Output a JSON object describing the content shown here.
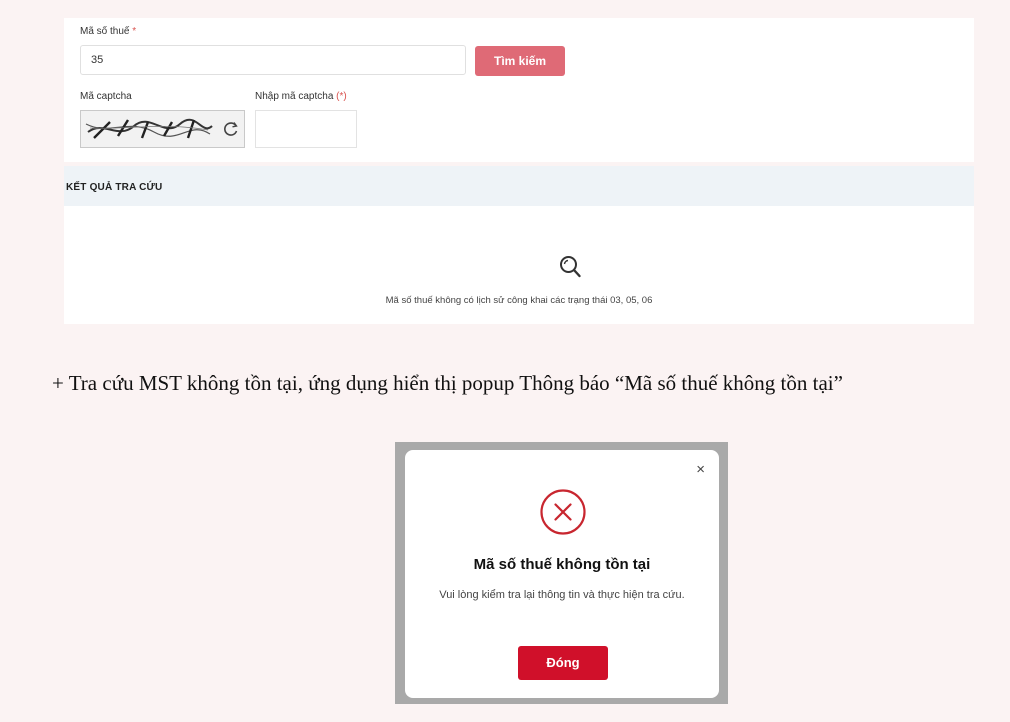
{
  "form": {
    "tax_code_label": "Mã số thuế",
    "tax_code_required": "*",
    "tax_code_value": "35",
    "search_button": "Tìm kiếm",
    "captcha_label": "Mã captcha",
    "captcha_input_label": "Nhập mã captcha",
    "captcha_input_required": "(*)"
  },
  "results": {
    "header": "KẾT QUẢ TRA CỨU",
    "message": "Mã số thuế không có lịch sử công khai các trạng thái 03, 05, 06"
  },
  "document": {
    "paragraph": "+ Tra cứu MST không tồn tại, ứng dụng hiển thị popup Thông báo “Mã số thuế không tồn tại”"
  },
  "popup": {
    "close": "×",
    "title": "Mã số thuế không tồn tại",
    "message": "Vui lòng kiểm tra lại thông tin và thực hiện tra cứu.",
    "button": "Đóng"
  },
  "colors": {
    "search_button": "#df6a76",
    "popup_button": "#d0102a",
    "error_icon": "#c8262f"
  },
  "icons": {
    "refresh": "refresh-icon",
    "result_search": "search-icon",
    "error": "error-circle-x-icon",
    "close": "close-icon"
  }
}
